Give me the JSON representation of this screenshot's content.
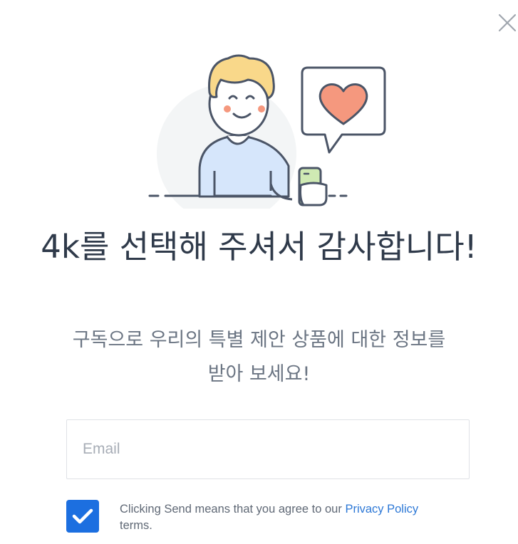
{
  "dialog": {
    "title": "4k를 선택해 주셔서 감사합니다!",
    "subtitle": "구독으로 우리의 특별 제안 상품에 대한 정보를 받아 보세요!",
    "email_placeholder": "Email",
    "email_value": "",
    "consent_checked": true,
    "consent_prefix": "Clicking Send means that you agree to our ",
    "consent_link": "Privacy Policy",
    "consent_suffix": "terms."
  },
  "icons": {
    "close": "close-icon",
    "illustration": "person-with-phone-heart-illustration",
    "check": "checkmark-icon"
  },
  "colors": {
    "accent": "#1c6fe0",
    "link": "#2d78d6",
    "heart": "#f5987e",
    "shirt": "#d6e6fb",
    "hair": "#f9d88a",
    "phone": "#cfeab3"
  }
}
